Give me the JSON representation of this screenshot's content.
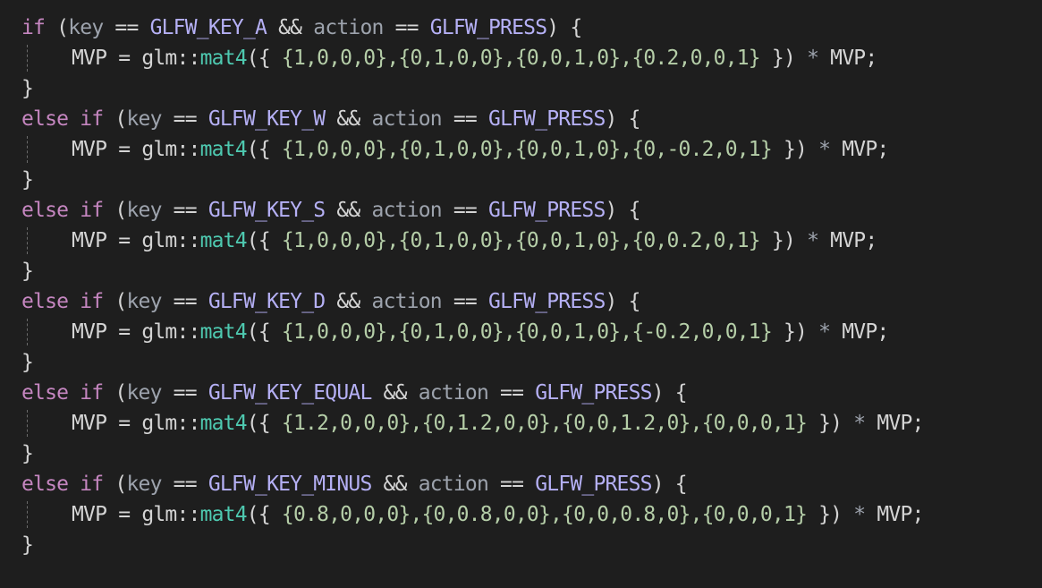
{
  "blocks": [
    {
      "lead": "",
      "keyword": "if",
      "key_macro": "GLFW_KEY_A",
      "matrix": "{1,0,0,0},{0,1,0,0},{0,0,1,0},{0.2,0,0,1}"
    },
    {
      "lead": "else ",
      "keyword": "if",
      "key_macro": "GLFW_KEY_W",
      "matrix": "{1,0,0,0},{0,1,0,0},{0,0,1,0},{0,-0.2,0,1}"
    },
    {
      "lead": "else ",
      "keyword": "if",
      "key_macro": "GLFW_KEY_S",
      "matrix": "{1,0,0,0},{0,1,0,0},{0,0,1,0},{0,0.2,0,1}"
    },
    {
      "lead": "else ",
      "keyword": "if",
      "key_macro": "GLFW_KEY_D",
      "matrix": "{1,0,0,0},{0,1,0,0},{0,0,1,0},{-0.2,0,0,1}"
    },
    {
      "lead": "else ",
      "keyword": "if",
      "key_macro": "GLFW_KEY_EQUAL",
      "matrix": "{1.2,0,0,0},{0,1.2,0,0},{0,0,1.2,0},{0,0,0,1}"
    },
    {
      "lead": "else ",
      "keyword": "if",
      "key_macro": "GLFW_KEY_MINUS",
      "matrix": "{0.8,0,0,0},{0,0.8,0,0},{0,0,0.8,0},{0,0,0,1}"
    }
  ],
  "tokens": {
    "open_paren": " (",
    "key_var": "key",
    "eq": " == ",
    "and": " && ",
    "action_var": "action",
    "press_macro": "GLFW_PRESS",
    "close_paren_brace": ") {",
    "mvp": "MVP",
    "assign": " = ",
    "glm_ns": "glm::",
    "mat_type": "mat4",
    "call_open": "({ ",
    "call_close": " }) ",
    "times": "*",
    "mvp_end": " MVP;",
    "close_brace": "}"
  },
  "colors": {
    "background": "#1e1e1e",
    "keyword": "#c586c0",
    "macro": "#b5b0f5",
    "type": "#4ec9b0",
    "number": "#b5cea8",
    "text": "#d4d4d4"
  }
}
